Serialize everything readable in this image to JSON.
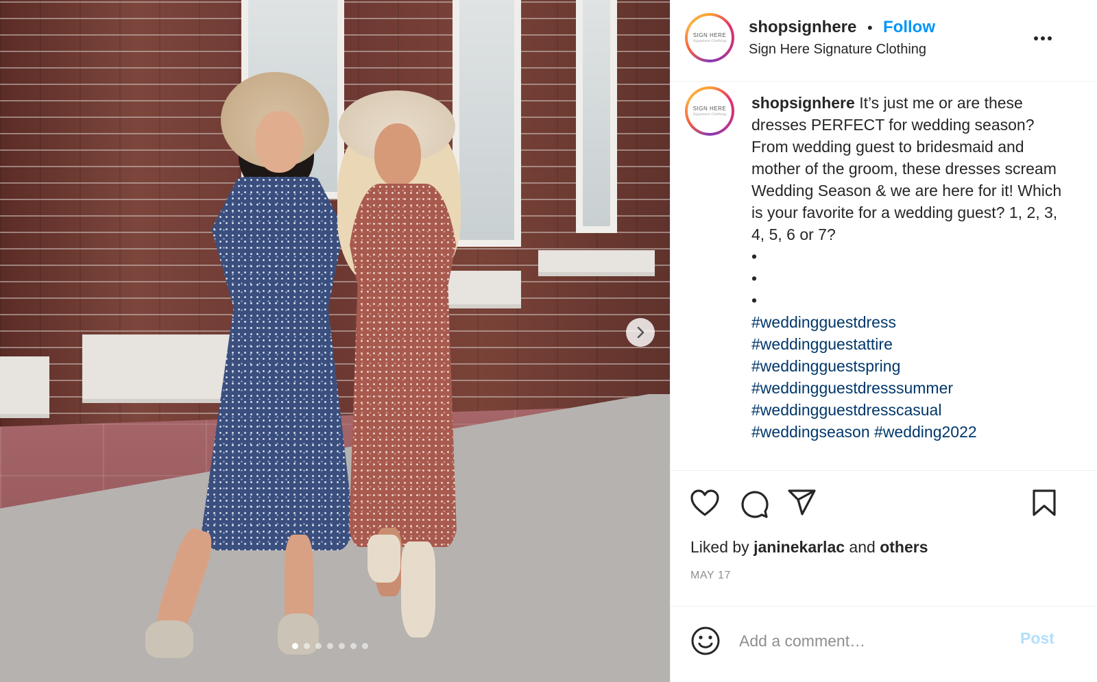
{
  "post": {
    "author": "shopsignhere",
    "separator": "•",
    "follow_label": "Follow",
    "subtitle": "Sign Here Signature Clothing",
    "avatar_text": "SIGN HERE",
    "avatar_script": "Signature Clothing",
    "more_icon": "more-horizontal-icon"
  },
  "media": {
    "next_icon": "chevron-right-icon",
    "carousel_count": 7,
    "carousel_active_index": 0
  },
  "caption": {
    "username": "shopsignhere",
    "text": "It’s just me or are these dresses PERFECT for wedding season? From wedding guest to bridesmaid and mother of the groom, these dresses scream Wedding Season & we are here for it! Which is your favorite for a wedding guest? 1, 2, 3, 4, 5, 6 or 7?",
    "bullets": [
      "•",
      "•",
      "•"
    ],
    "hashtags": [
      "#weddingguestdress",
      "#weddingguestattire",
      "#weddingguestspring",
      "#weddingguestdresssummer",
      "#weddingguestdresscasual",
      "#weddingseason",
      "#wedding2022"
    ]
  },
  "actions": {
    "like_icon": "heart-icon",
    "comment_icon": "comment-icon",
    "share_icon": "send-icon",
    "save_icon": "bookmark-icon",
    "liked_by_prefix": "Liked by",
    "liked_by_user": "janinekarlac",
    "liked_by_and": "and",
    "liked_by_others": "others",
    "date": "MAY 17"
  },
  "comment": {
    "emoji_icon": "smiley-icon",
    "placeholder": "Add a comment…",
    "post_label": "Post"
  },
  "colors": {
    "accent": "#0095f6",
    "hashtag": "#00376b",
    "post_disabled": "#b2dffc",
    "muted": "#8e8e8e"
  }
}
